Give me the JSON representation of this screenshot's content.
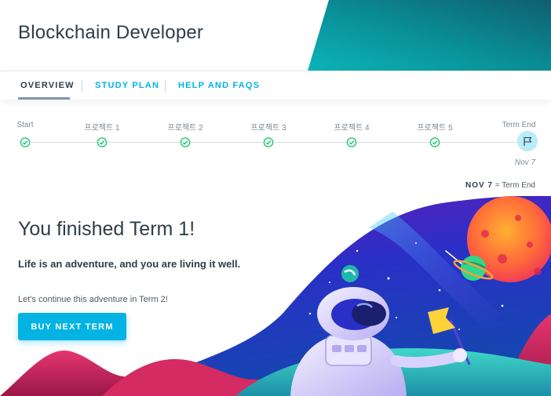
{
  "header": {
    "title": "Blockchain Developer"
  },
  "tabs": [
    {
      "label": "OVERVIEW"
    },
    {
      "label": "STUDY PLAN"
    },
    {
      "label": "HELP AND FAQS"
    }
  ],
  "timeline": {
    "steps": [
      {
        "label": "Start"
      },
      {
        "label": "프로젝트 1"
      },
      {
        "label": "프로젝트 2"
      },
      {
        "label": "프로젝트 3"
      },
      {
        "label": "프로젝트 4"
      },
      {
        "label": "프로젝트 5"
      },
      {
        "label": "Term End"
      }
    ],
    "end_date": "Nov 7"
  },
  "legend": {
    "date": "NOV 7",
    "text": "= Term End"
  },
  "main": {
    "title": "You finished Term 1!",
    "tagline": "Life is an adventure, and you are living it well.",
    "continue_text": "Let's continue this adventure in Term 2!",
    "button_label": "BUY NEXT TERM"
  },
  "colors": {
    "accent": "#02b3e4",
    "text": "#2e3d49",
    "check": "#15c26b",
    "end_circle": "#b8ecf9"
  },
  "icons": {
    "step": "check-circle-icon",
    "end": "flag-icon"
  }
}
